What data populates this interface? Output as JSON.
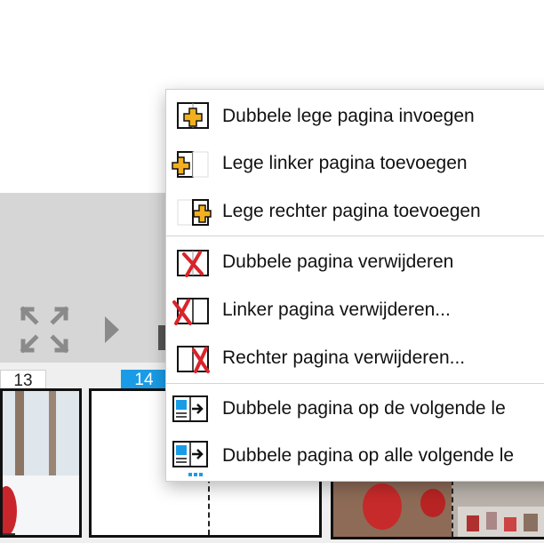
{
  "pages": {
    "left_number": "13",
    "current_number": "14"
  },
  "context_menu": {
    "items": [
      {
        "label": "Dubbele lege pagina invoegen",
        "icon": "insert-spread-icon"
      },
      {
        "label": "Lege linker pagina toevoegen",
        "icon": "add-left-page-icon"
      },
      {
        "label": "Lege rechter pagina toevoegen",
        "icon": "add-right-page-icon"
      },
      {
        "label": "Dubbele pagina verwijderen",
        "icon": "delete-spread-icon"
      },
      {
        "label": "Linker pagina verwijderen...",
        "icon": "delete-left-page-icon"
      },
      {
        "label": "Rechter pagina verwijderen...",
        "icon": "delete-right-page-icon"
      },
      {
        "label": "Dubbele pagina op de volgende le",
        "icon": "spread-to-next-icon"
      },
      {
        "label": "Dubbele pagina op alle volgende le",
        "icon": "spread-to-all-following-icon"
      }
    ]
  },
  "colors": {
    "accent_blue": "#1a9be6",
    "plus_orange": "#f2b01e",
    "delete_red": "#d9242b"
  }
}
